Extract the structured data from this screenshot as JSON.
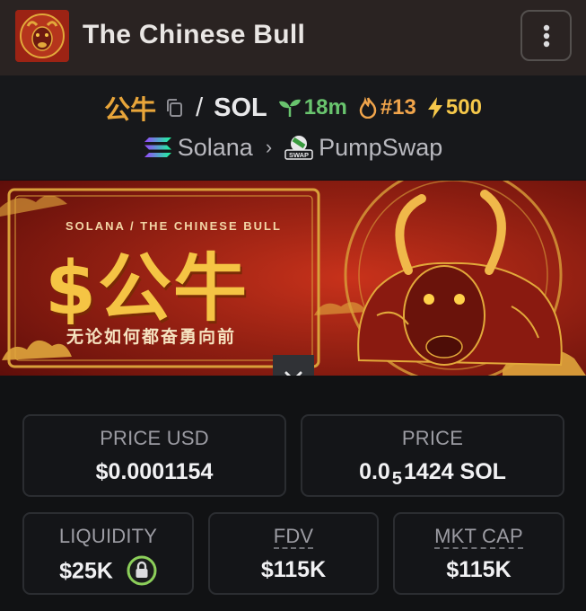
{
  "header": {
    "title": "The Chinese Bull",
    "menu_icon": "kebab-menu-icon"
  },
  "pair": {
    "base": "公牛",
    "quote": "SOL",
    "age": "18m",
    "rank": "#13",
    "boosts": "500",
    "colors": {
      "base": "#e8a53a",
      "age": "#69c46e",
      "rank": "#f0a44b",
      "boost": "#f6c84a"
    }
  },
  "chain": {
    "network": "Solana",
    "dex": "PumpSwap",
    "dex_badge": "SWAP"
  },
  "banner": {
    "subtitle": "SOLANA / THE CHINESE BULL",
    "ticker": "$公牛",
    "slogan": "无论如何都奋勇向前"
  },
  "stats": {
    "price_usd": {
      "label": "PRICE USD",
      "value": "$0.0001154"
    },
    "price_sol": {
      "label": "PRICE",
      "prefix": "0.0",
      "subscript": "5",
      "digits": "1424",
      "unit": "SOL"
    },
    "liquidity": {
      "label": "LIQUIDITY",
      "value": "$25K",
      "locked": true
    },
    "fdv": {
      "label": "FDV",
      "value": "$115K"
    },
    "mkt_cap": {
      "label": "MKT CAP",
      "value": "$115K"
    }
  }
}
